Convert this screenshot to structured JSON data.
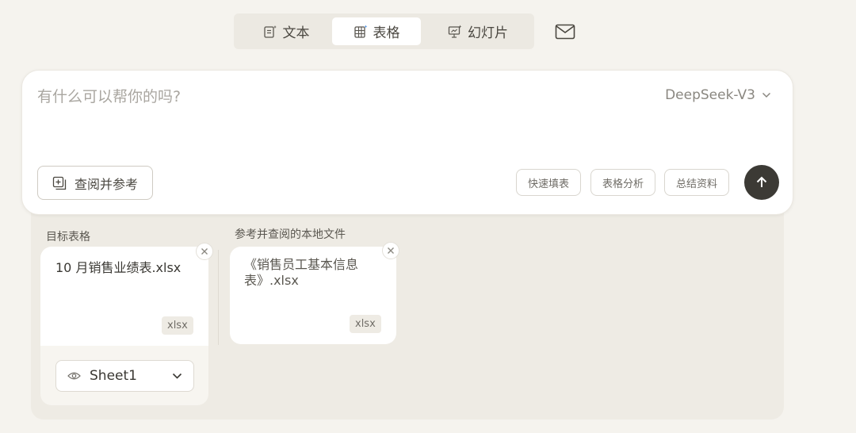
{
  "tabs": [
    {
      "label": "文本",
      "icon": "doc-sparkle-icon",
      "active": false
    },
    {
      "label": "表格",
      "icon": "table-sparkle-icon",
      "active": true
    },
    {
      "label": "幻灯片",
      "icon": "slides-sparkle-icon",
      "active": false
    }
  ],
  "mail": {
    "icon": "mail-icon"
  },
  "prompt": {
    "placeholder": "有什么可以帮你的吗?",
    "value": ""
  },
  "model": {
    "selected": "DeepSeek-V3"
  },
  "reference_button": {
    "label": "查阅并参考",
    "icon": "add-square-icon"
  },
  "quick_actions": [
    {
      "label": "快速填表"
    },
    {
      "label": "表格分析"
    },
    {
      "label": "总结资料"
    }
  ],
  "send": {
    "icon": "arrow-up-icon"
  },
  "target_section": {
    "label": "目标表格",
    "file": {
      "name": "10 月销售业绩表.xlsx",
      "ext": "xlsx"
    },
    "sheet": {
      "selected": "Sheet1"
    }
  },
  "reference_section": {
    "label": "参考并查阅的本地文件",
    "file": {
      "name": "《销售员工基本信息表》.xlsx",
      "ext": "xlsx"
    }
  },
  "colors": {
    "background": "#f5f3ee",
    "panel": "#eeebe4",
    "send_button": "#3c3a35",
    "muted_text": "#a9a6a0"
  }
}
